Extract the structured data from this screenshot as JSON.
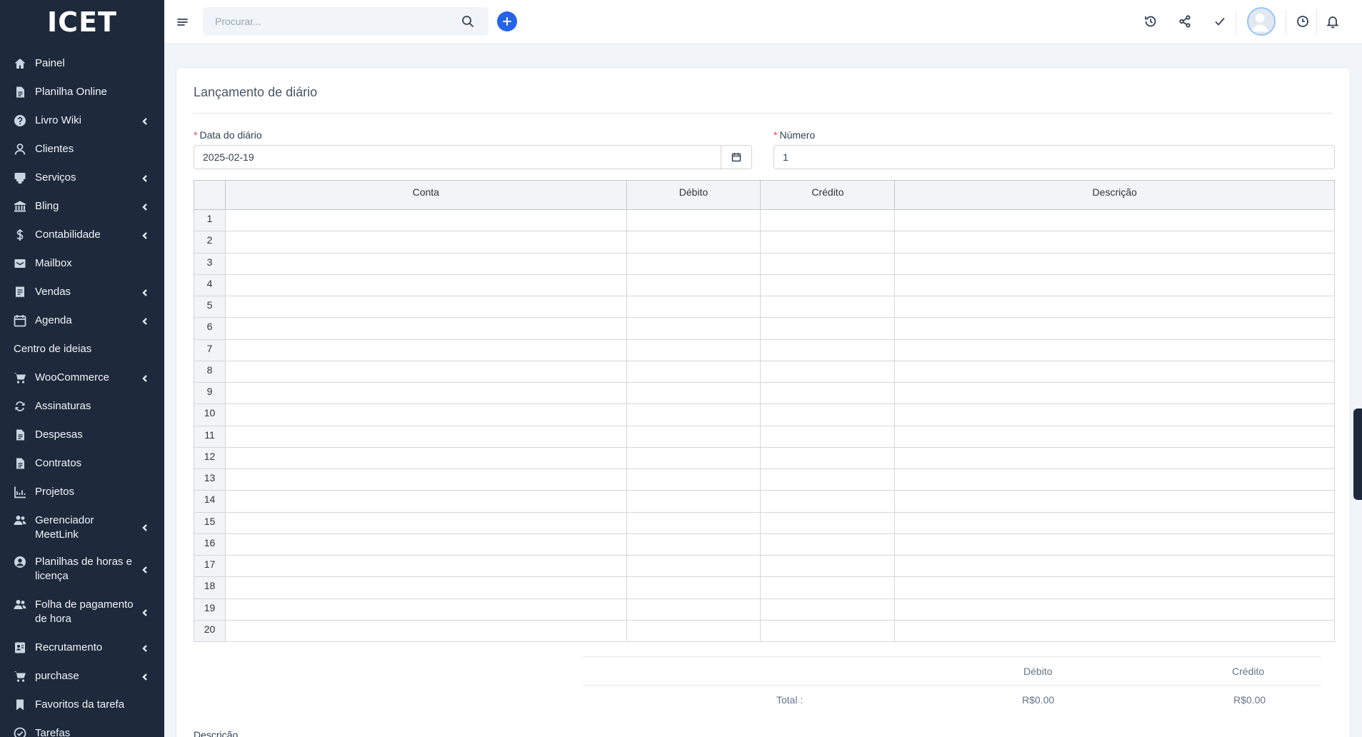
{
  "logo": {
    "text": "ICET"
  },
  "sidebar": {
    "items": [
      {
        "label": "Painel",
        "icon": "home-icon",
        "chevron": false
      },
      {
        "label": "Planilha Online",
        "icon": "file-icon",
        "chevron": false
      },
      {
        "label": "Livro Wiki",
        "icon": "question-icon",
        "chevron": true
      },
      {
        "label": "Clientes",
        "icon": "user-icon",
        "chevron": false
      },
      {
        "label": "Serviços",
        "icon": "support-icon",
        "chevron": true
      },
      {
        "label": "Bling",
        "icon": "bank-icon",
        "chevron": true
      },
      {
        "label": "Contabilidade",
        "icon": "dollar-icon",
        "chevron": true
      },
      {
        "label": "Mailbox",
        "icon": "mail-icon",
        "chevron": false
      },
      {
        "label": "Vendas",
        "icon": "receipt-icon",
        "chevron": true
      },
      {
        "label": "Agenda",
        "icon": "calendar-icon",
        "chevron": true
      },
      {
        "label": "Centro de ideias",
        "icon": "",
        "chevron": false
      },
      {
        "label": "WooCommerce",
        "icon": "cart-icon",
        "chevron": true
      },
      {
        "label": "Assinaturas",
        "icon": "refresh-icon",
        "chevron": false
      },
      {
        "label": "Despesas",
        "icon": "file-icon",
        "chevron": false
      },
      {
        "label": "Contratos",
        "icon": "file-icon",
        "chevron": false
      },
      {
        "label": "Projetos",
        "icon": "chart-icon",
        "chevron": false
      },
      {
        "label": "Gerenciador MeetLink",
        "icon": "users-icon",
        "chevron": true
      },
      {
        "label": "Planilhas de horas e licença",
        "icon": "user-circle-icon",
        "chevron": true
      },
      {
        "label": "Folha de pagamento de hora",
        "icon": "users-icon",
        "chevron": true
      },
      {
        "label": "Recrutamento",
        "icon": "id-card-icon",
        "chevron": true
      },
      {
        "label": "purchase",
        "icon": "cart-icon",
        "chevron": true
      },
      {
        "label": "Favoritos da tarefa",
        "icon": "bookmark-icon",
        "chevron": false
      },
      {
        "label": "Tarefas",
        "icon": "check-circle-icon",
        "chevron": false
      }
    ]
  },
  "topbar": {
    "search_placeholder": "Procurar...",
    "accent": "#2563eb"
  },
  "page": {
    "title": "Lançamento de diário",
    "date_label": "Data do diário",
    "date_value": "2025-02-19",
    "number_label": "Número",
    "number_value": "1"
  },
  "grid": {
    "headers": [
      "Conta",
      "Débito",
      "Crédito",
      "Descrição"
    ],
    "row_numbers": [
      "1",
      "2",
      "3",
      "4",
      "5",
      "6",
      "7",
      "8",
      "9",
      "10",
      "11",
      "12",
      "13",
      "14",
      "15",
      "16",
      "17",
      "18",
      "19",
      "20"
    ]
  },
  "totals": {
    "debit_header": "Débito",
    "credit_header": "Crédito",
    "total_label": "Total :",
    "debit_total": "R$0.00",
    "credit_total": "R$0.00"
  },
  "description_label": "Descrição"
}
